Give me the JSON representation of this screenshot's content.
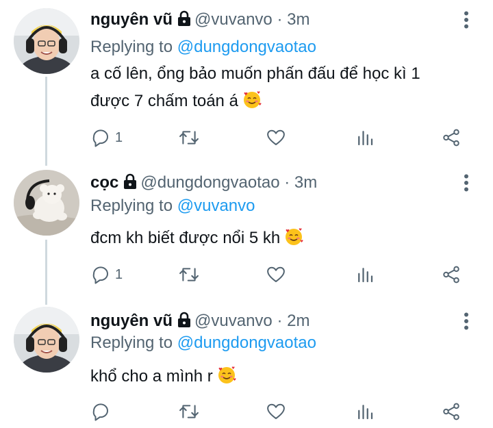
{
  "colors": {
    "accent": "#1d9bf0",
    "muted": "#536471",
    "text": "#0f1419",
    "thread_line": "#cfd9de"
  },
  "tweets": [
    {
      "name": "nguyên vũ",
      "handle": "@vuvanvo",
      "time_sep": "·",
      "time": "3m",
      "replying_prefix": "Replying to",
      "replying_to": "@dungdongvaotao",
      "text_line1": "a cố lên, ổng bảo muốn phấn đấu để học kì 1",
      "text_line2": "được 7 chấm toán á",
      "emoji": "smiling-face-with-hearts",
      "reply_count": "1",
      "avatar": "person-with-headphones-yellow-hat"
    },
    {
      "name": "cọc",
      "handle": "@dungdongvaotao",
      "time_sep": "·",
      "time": "3m",
      "replying_prefix": "Replying to",
      "replying_to": "@vuvanvo",
      "text_line1": "đcm kh biết được nổi 5 kh",
      "emoji": "smiling-face-with-hearts",
      "reply_count": "1",
      "avatar": "white-plush-toy"
    },
    {
      "name": "nguyên vũ",
      "handle": "@vuvanvo",
      "time_sep": "·",
      "time": "2m",
      "replying_prefix": "Replying to",
      "replying_to": "@dungdongvaotao",
      "text_line1": "khổ cho a mình r",
      "emoji": "smiling-face-with-hearts",
      "reply_count": "",
      "avatar": "person-with-headphones-yellow-hat"
    }
  ],
  "icons": {
    "reply": "reply-icon",
    "retweet": "retweet-icon",
    "like": "like-icon",
    "views": "views-icon",
    "share": "share-icon",
    "more": "more-options-icon",
    "lock": "lock-icon"
  }
}
